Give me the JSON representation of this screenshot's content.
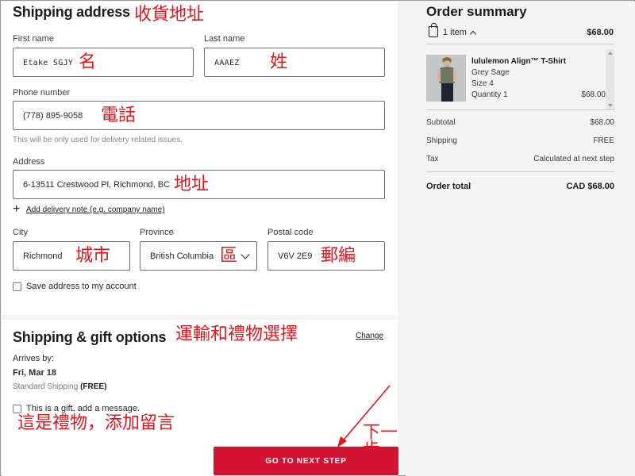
{
  "shipping_address": {
    "title": "Shipping address",
    "title_cn": "收貨地址",
    "first_name": {
      "label": "First name",
      "value": "Etake SGJY",
      "annotation": "名"
    },
    "last_name": {
      "label": "Last name",
      "value": "AAAEZ",
      "annotation": "姓"
    },
    "phone": {
      "label": "Phone number",
      "value": "(778) 895-9058",
      "annotation": "電話",
      "hint": "This will be only used for delivery related issues."
    },
    "address": {
      "label": "Address",
      "value": "6-13511 Crestwood Pl, Richmond, BC",
      "annotation": "地址"
    },
    "delivery_note_link": "Add delivery note (e.g. company name)",
    "city": {
      "label": "City",
      "value": "Richmond",
      "annotation": "城市"
    },
    "province": {
      "label": "Province",
      "value": "British Columbia",
      "annotation": "區"
    },
    "postal": {
      "label": "Postal code",
      "value": "V6V 2E9",
      "annotation": "郵編"
    },
    "save_address_label": "Save address to my account"
  },
  "shipping_gift": {
    "title": "Shipping & gift options",
    "title_cn": "運輸和禮物選擇",
    "change_link": "Change",
    "arrives_label": "Arrives by:",
    "arrives_date": "Fri, Mar 18",
    "method": "Standard Shipping",
    "method_price": "(FREE)",
    "gift_label": "This is a gift, add a message.",
    "gift_cn": "這是禮物，添加留言",
    "next_cn": "下一步"
  },
  "cta": {
    "label": "GO TO NEXT STEP"
  },
  "order_summary": {
    "title": "Order summary",
    "items_count": "1 item",
    "total_top": "$68.00",
    "product": {
      "name": "lululemon Align™ T-Shirt",
      "color": "Grey Sage",
      "size": "Size 4",
      "quantity": "Quantity 1",
      "price": "$68.00"
    },
    "subtotal_label": "Subtotal",
    "subtotal_value": "$68.00",
    "shipping_label": "Shipping",
    "shipping_value": "FREE",
    "tax_label": "Tax",
    "tax_value": "Calculated at next step",
    "total_label": "Order total",
    "total_value": "CAD $68.00"
  },
  "colors": {
    "accent": "#d31334",
    "annotation": "#e8141c"
  }
}
